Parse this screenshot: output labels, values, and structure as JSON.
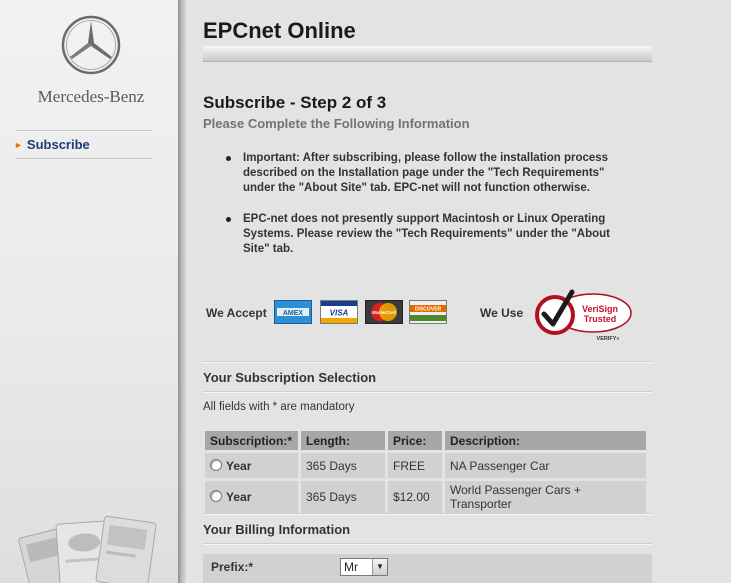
{
  "sidebar": {
    "brand": "Mercedes-Benz",
    "nav": [
      {
        "label": "Subscribe"
      }
    ]
  },
  "header": {
    "title": "EPCnet Online"
  },
  "step": {
    "title": "Subscribe - Step 2 of 3",
    "subtitle": "Please Complete the Following Information"
  },
  "notices": [
    "Important: After subscribing, please follow the installation process described on the Installation page under the \"Tech Requirements\" under the \"About Site\" tab. EPC-net will not function otherwise.",
    "EPC-net does not presently support Macintosh or Linux Operating Systems. Please review the \"Tech Requirements\" under the \"About Site\" tab."
  ],
  "payment": {
    "accept_label": "We Accept",
    "cards": [
      "AMEX",
      "VISA",
      "MasterCard",
      "DISCOVER"
    ],
    "use_label": "We Use",
    "verisign_line1": "VeriSign",
    "verisign_line2": "Trusted",
    "verisign_verify": "VERIFY»"
  },
  "subscription": {
    "section_title": "Your Subscription Selection",
    "mandatory_note": "All fields with * are mandatory",
    "columns": [
      "Subscription:*",
      "Length:",
      "Price:",
      "Description:"
    ],
    "rows": [
      {
        "option": "Year",
        "length": "365 Days",
        "price": "FREE",
        "description": "NA Passenger Car"
      },
      {
        "option": "Year",
        "length": "365 Days",
        "price": "$12.00",
        "description": "World Passenger Cars + Transporter"
      }
    ]
  },
  "billing": {
    "section_title": "Your Billing Information",
    "prefix_label": "Prefix:*",
    "prefix_value": "Mr"
  },
  "colors": {
    "nav_link": "#1f3c7a",
    "nav_arrow": "#e07b00",
    "table_header": "#a7a7a7",
    "table_cell": "#d1d1d1",
    "verisign_red": "#c8102e"
  }
}
